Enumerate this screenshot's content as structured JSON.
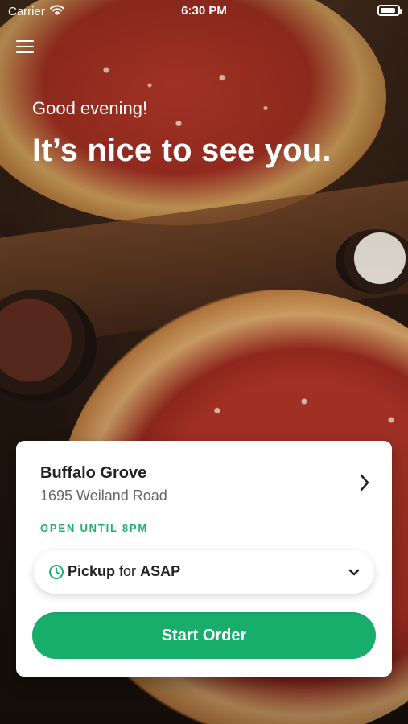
{
  "status_bar": {
    "carrier": "Carrier",
    "time": "6:30 PM",
    "icons": [
      "wifi-icon",
      "battery-icon"
    ]
  },
  "header": {
    "menu_icon": "hamburger-menu-icon"
  },
  "greeting": {
    "small": "Good evening!",
    "headline": "It’s nice to see you."
  },
  "location_card": {
    "store_name": "Buffalo Grove",
    "address": "1695 Weiland Road",
    "status": "OPEN UNTIL 8PM",
    "chevron_icon": "chevron-right-icon",
    "pickup": {
      "mode": "Pickup",
      "connector": "for",
      "time": "ASAP",
      "clock_icon": "clock-icon",
      "dropdown_icon": "chevron-down-icon"
    },
    "start_order_label": "Start Order"
  },
  "colors": {
    "accent_green": "#17ad6b",
    "status_green": "#1fb06d"
  }
}
